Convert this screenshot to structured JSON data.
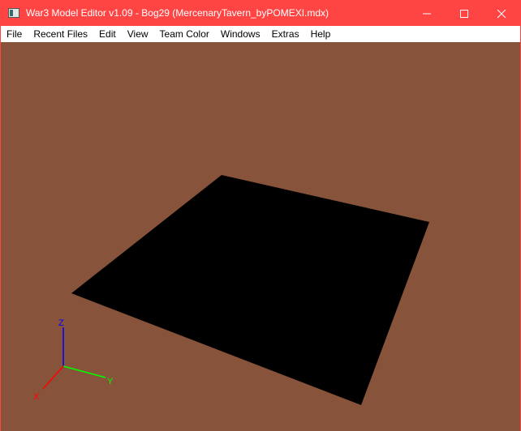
{
  "window": {
    "title": "War3 Model Editor v1.09 - Bog29 (MercenaryTavern_byPOMEXI.mdx)"
  },
  "menu": [
    "File",
    "Recent Files",
    "Edit",
    "View",
    "Team Color",
    "Windows",
    "Extras",
    "Help"
  ],
  "viewport": {
    "background": "#87533a",
    "axes": {
      "x": "X",
      "y": "Y",
      "z": "Z"
    },
    "axis_colors": {
      "x": "#ff0000",
      "y": "#00ff00",
      "z": "#0000ff"
    }
  }
}
